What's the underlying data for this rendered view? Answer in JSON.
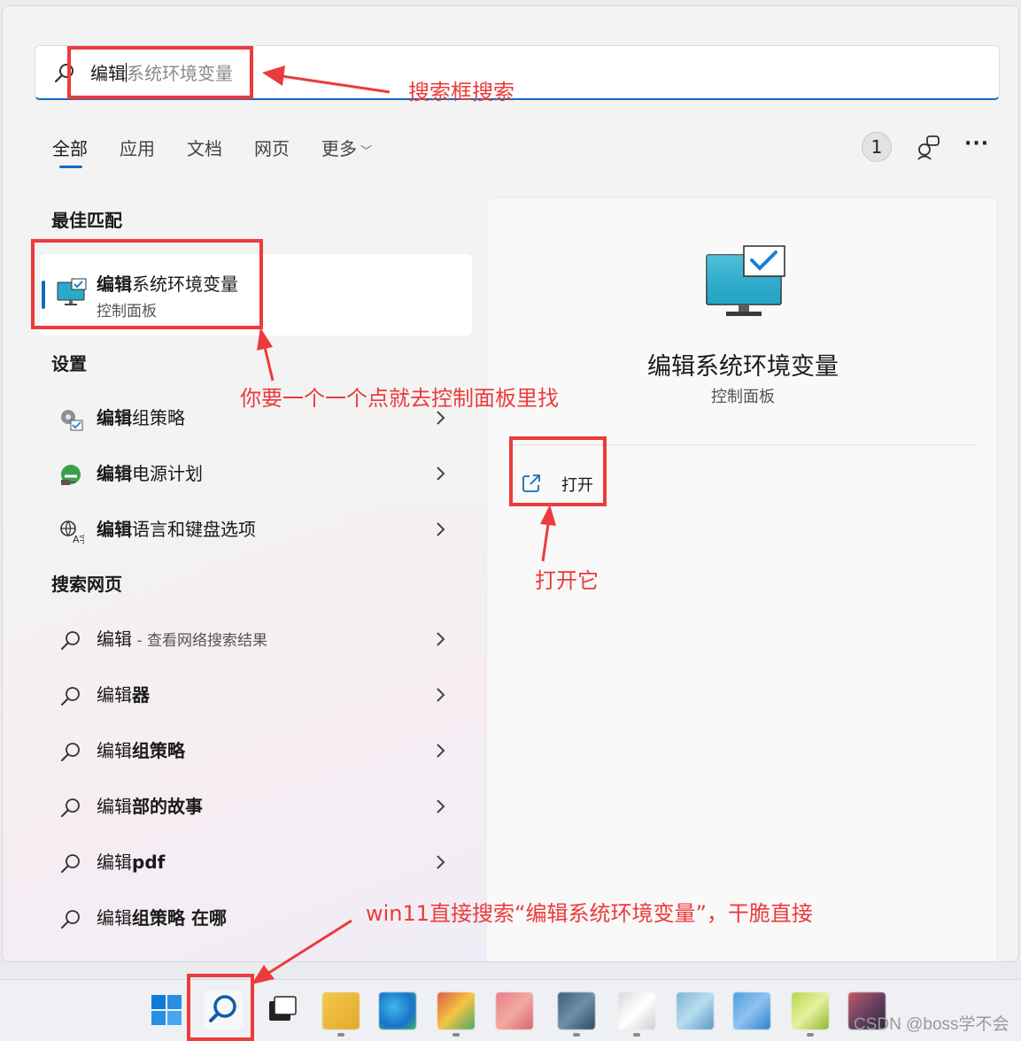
{
  "search": {
    "typed": "编辑",
    "suggestion": "系统环境变量"
  },
  "tabs": [
    {
      "label": "全部"
    },
    {
      "label": "应用"
    },
    {
      "label": "文档"
    },
    {
      "label": "网页"
    },
    {
      "label": "更多"
    }
  ],
  "header": {
    "count_badge": "1"
  },
  "best_match": {
    "heading": "最佳匹配",
    "title_bold": "编辑",
    "title_rest": "系统环境变量",
    "subtitle": "控制面板"
  },
  "settings": {
    "heading": "设置",
    "items": [
      {
        "bold": "编辑",
        "rest": "组策略"
      },
      {
        "bold": "编辑",
        "rest": "电源计划"
      },
      {
        "bold": "编辑",
        "rest": "语言和键盘选项"
      }
    ]
  },
  "web": {
    "heading": "搜索网页",
    "items": [
      {
        "bold": "",
        "rest": "编辑",
        "muted": " - 查看网络搜索结果"
      },
      {
        "bold": "",
        "rest": "编辑",
        "bold_tail": "器"
      },
      {
        "bold": "",
        "rest": "编辑",
        "bold_tail": "组策略"
      },
      {
        "bold": "",
        "rest": "编辑",
        "bold_tail": "部的故事"
      },
      {
        "bold": "",
        "rest": "编辑",
        "bold_tail": "pdf"
      },
      {
        "bold": "",
        "rest": "编辑",
        "bold_tail": "组策略 在哪"
      }
    ]
  },
  "detail": {
    "title": "编辑系统环境变量",
    "subtitle": "控制面板",
    "open_label": "打开"
  },
  "annotations": {
    "search_note": "搜索框搜索",
    "control_panel_note": "你要一个一个点就去控制面板里找",
    "open_note": "打开它",
    "win11_note": "win11直接搜索“编辑系统环境变量”，干脆直接"
  },
  "watermark": "CSDN @boss学不会",
  "colors": {
    "accent": "#0f6cbd",
    "annotation": "#ec3b3b"
  }
}
